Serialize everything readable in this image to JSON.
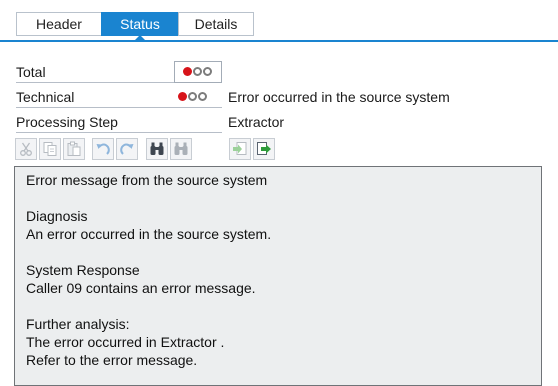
{
  "tabs": [
    {
      "label": "Header",
      "active": false
    },
    {
      "label": "Status",
      "active": true
    },
    {
      "label": "Details",
      "active": false
    }
  ],
  "fields": {
    "total": {
      "label": "Total",
      "status": "red"
    },
    "technical": {
      "label": "Technical",
      "status": "red",
      "text": "Error occurred in the source system"
    },
    "processing_step": {
      "label": "Processing Step",
      "value": "Extractor"
    }
  },
  "toolbar": {
    "buttons": [
      {
        "name": "cut",
        "enabled": false
      },
      {
        "name": "copy",
        "enabled": false
      },
      {
        "name": "paste",
        "enabled": false
      },
      {
        "name": "undo",
        "enabled": false
      },
      {
        "name": "redo",
        "enabled": false
      },
      {
        "name": "find",
        "enabled": true
      },
      {
        "name": "find-next",
        "enabled": false
      },
      {
        "name": "import",
        "enabled": false
      },
      {
        "name": "export",
        "enabled": true
      }
    ]
  },
  "message": {
    "lines": [
      "Error message from the source system",
      "",
      "Diagnosis",
      "An error occurred in the source system.",
      "",
      "System Response",
      "Caller 09 contains an error message.",
      "",
      "Further analysis:",
      "The error occurred in Extractor .",
      "Refer to the error message."
    ]
  },
  "colors": {
    "accent": "#1a84d0",
    "status_red": "#d7141a",
    "status_off": "#7c7c7c",
    "textarea_bg": "#eceeef"
  }
}
